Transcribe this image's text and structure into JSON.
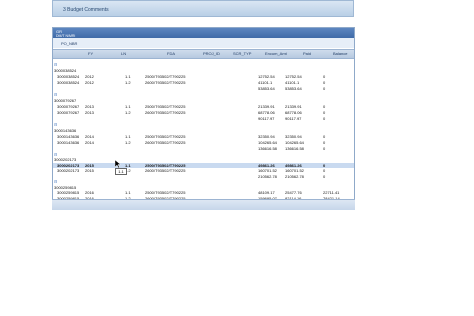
{
  "top_bar": {
    "label": "3 Budget Comments"
  },
  "panel": {
    "title_1": "GR",
    "title_2": "DM/T N/MRI",
    "po_label": "PO_NBR"
  },
  "columns": [
    "FY",
    "LN",
    "FDA",
    "PROJ_ID",
    "SCR_TYP",
    "Encum_Amt",
    "Paid",
    "Balance"
  ],
  "groups": [
    {
      "id": "3000038524",
      "rows": [
        {
          "po": "3000038524",
          "fy": "2012",
          "ln": "1.1",
          "fda": "2500/T93502/T790225",
          "encum": "12752.54",
          "paid": "12752.54",
          "bal": "0"
        },
        {
          "po": "3000038524",
          "fy": "2012",
          "ln": "1.2",
          "fda": "2600/T93502/T790225",
          "encum": "41101.1",
          "paid": "41101.1",
          "bal": "0"
        }
      ],
      "total": {
        "encum": "53853.64",
        "paid": "53853.64",
        "bal": "0"
      }
    },
    {
      "id": "3000079267",
      "rows": [
        {
          "po": "3000079267",
          "fy": "2013",
          "ln": "1.1",
          "fda": "2500/T93502/T790225",
          "encum": "21339.91",
          "paid": "21339.91",
          "bal": "0"
        },
        {
          "po": "3000079267",
          "fy": "2013",
          "ln": "1.2",
          "fda": "2600/T93502/T790225",
          "encum": "68778.06",
          "paid": "68778.06",
          "bal": "0"
        }
      ],
      "total": {
        "encum": "90117.97",
        "paid": "90117.97",
        "bal": "0"
      }
    },
    {
      "id": "3000143636",
      "rows": [
        {
          "po": "3000143636",
          "fy": "2014",
          "ln": "1.1",
          "fda": "2500/T93502/T790225",
          "encum": "32350.94",
          "paid": "32350.94",
          "bal": "0"
        },
        {
          "po": "3000143636",
          "fy": "2014",
          "ln": "1.2",
          "fda": "2600/T93502/T790225",
          "encum": "104265.64",
          "paid": "104265.64",
          "bal": "0"
        }
      ],
      "total": {
        "encum": "136616.58",
        "paid": "136616.58",
        "bal": "0"
      }
    },
    {
      "id": "3000202173",
      "rows": [
        {
          "po": "3000202173",
          "fy": "2015",
          "ln": "1.1",
          "fda": "2500/T93502/T790225",
          "encum": "49861.26",
          "paid": "49861.26",
          "bal": "0"
        },
        {
          "po": "3000202173",
          "fy": "2015",
          "ln": "1.2",
          "fda": "2600/T93502/T790225",
          "encum": "160701.52",
          "paid": "160701.52",
          "bal": "0"
        }
      ],
      "total": {
        "encum": "210562.78",
        "paid": "210562.78",
        "bal": "0"
      }
    },
    {
      "id": "3000259815",
      "rows": [
        {
          "po": "3000259815",
          "fy": "2016",
          "ln": "1.1",
          "fda": "2500/T93502/T790225",
          "encum": "48109.17",
          "paid": "25477.76",
          "bal": "22711.41"
        },
        {
          "po": "3000259815",
          "fy": "2016",
          "ln": "1.2",
          "fda": "2600/T93502/T790225",
          "encum": "159695.07",
          "paid": "82114.16",
          "bal": "78421.14"
        }
      ],
      "total": {
        "encum": "207724.49",
        "paid": "107591.939999999",
        "bal": "100132.55"
      }
    }
  ],
  "tooltip": "1.1"
}
